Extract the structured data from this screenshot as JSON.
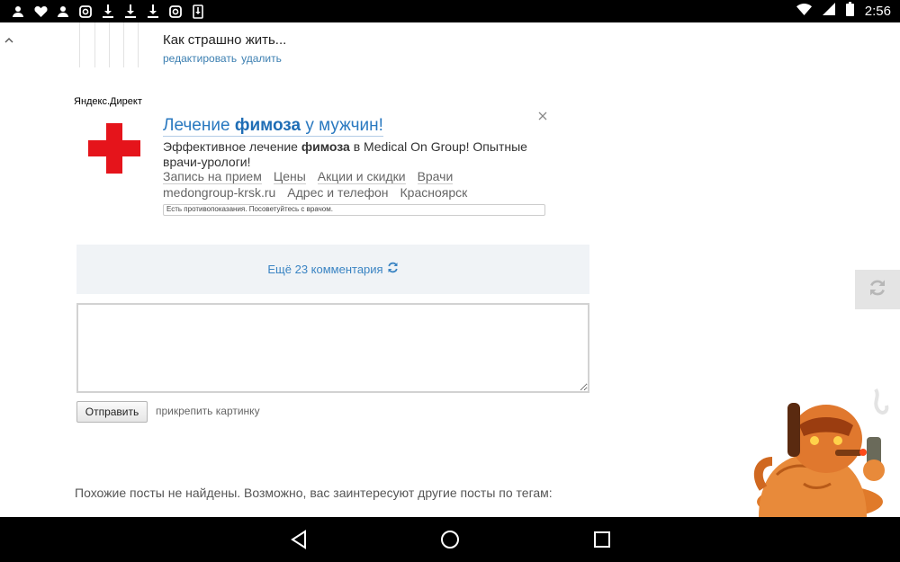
{
  "status_bar": {
    "time": "2:56",
    "left_icons": [
      "person-icon",
      "heart-icon",
      "person-icon",
      "instagram-icon",
      "download-icon",
      "download-icon",
      "download-icon",
      "instagram-icon",
      "download-box-icon"
    ],
    "right_icons": [
      "wifi-icon",
      "signal-icon",
      "battery-icon"
    ]
  },
  "comment": {
    "text": "Как страшно жить...",
    "edit_label": "редактировать",
    "delete_label": "удалить"
  },
  "ad": {
    "label": "Яндекс.Директ",
    "title_pre": "Лечение ",
    "title_bold": "фимоза",
    "title_post": " у мужчин!",
    "desc_pre": "Эффективное лечение ",
    "desc_bold": "фимоза",
    "desc_post": " в Medical On Group! Опытные врачи-урологи!",
    "links": [
      "Запись на прием",
      "Цены",
      "Акции и скидки",
      "Врачи"
    ],
    "domain": "medongroup-krsk.ru",
    "address": "Адрес и телефон",
    "city": "Красноярск",
    "warning": "Есть противопоказания. Посоветуйтесь с врачом.",
    "cross_color": "#e5141b"
  },
  "more_comments": {
    "label": "Ещё 23 комментария"
  },
  "form": {
    "submit_label": "Отправить",
    "attach_label": "прикрепить картинку"
  },
  "similar": {
    "text": "Похожие посты не найдены. Возможно, вас заинтересуют другие посты по тегам:"
  },
  "colors": {
    "link": "#3c7fb1",
    "ad_title": "#2a79c0",
    "more_bg": "#f0f3f6"
  }
}
